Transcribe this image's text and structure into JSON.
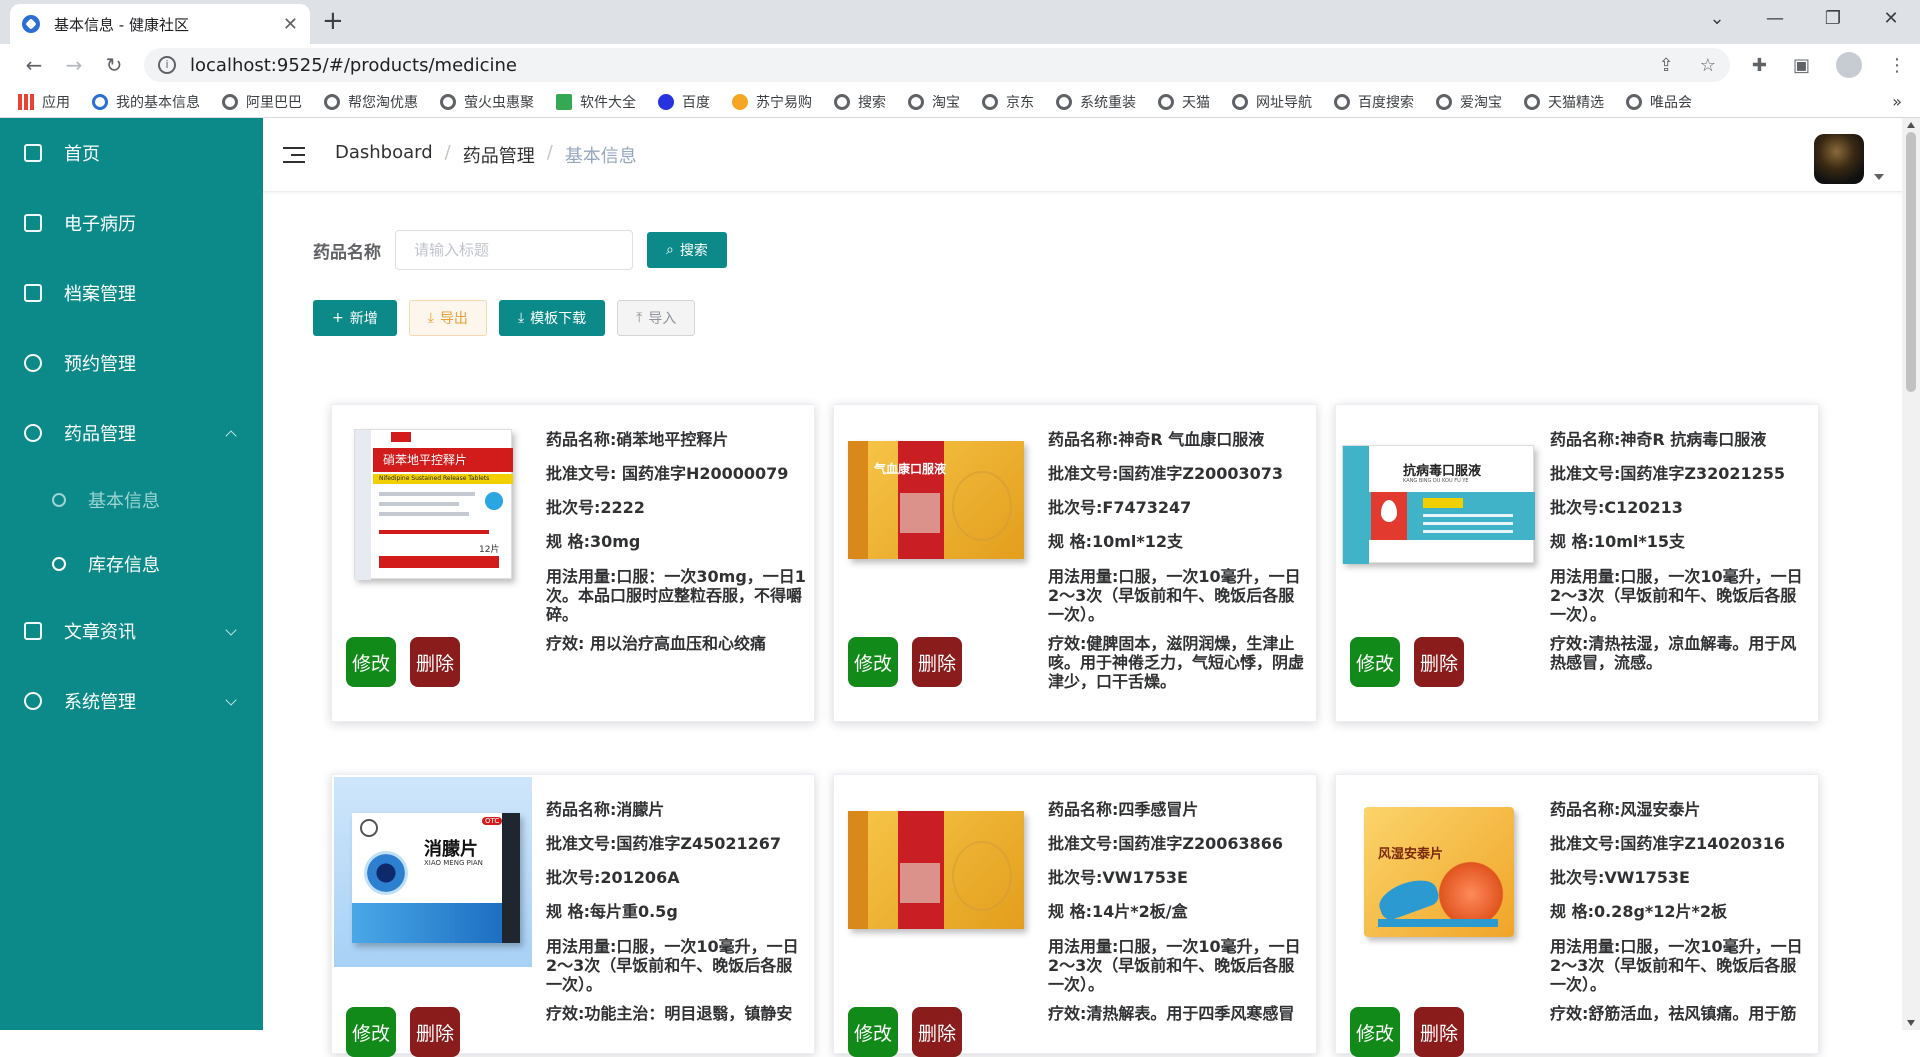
{
  "browser": {
    "tab_title": "基本信息 - 健康社区",
    "url": "localhost:9525/#/products/medicine",
    "bookmarks": [
      "应用",
      "我的基本信息",
      "阿里巴巴",
      "帮您淘优惠",
      "萤火虫惠聚",
      "软件大全",
      "百度",
      "苏宁易购",
      "搜索",
      "淘宝",
      "京东",
      "系统重装",
      "天猫",
      "网址导航",
      "百度搜索",
      "爱淘宝",
      "天猫精选",
      "唯品会"
    ],
    "bookmark_more": "»"
  },
  "sidebar": {
    "items": [
      {
        "label": "首页",
        "icon": "home-icon"
      },
      {
        "label": "电子病历",
        "icon": "document-icon"
      },
      {
        "label": "档案管理",
        "icon": "folder-icon"
      },
      {
        "label": "预约管理",
        "icon": "clock-icon"
      },
      {
        "label": "药品管理",
        "icon": "link-icon"
      },
      {
        "label": "基本信息",
        "icon": "link-icon"
      },
      {
        "label": "库存信息",
        "icon": "database-icon"
      },
      {
        "label": "文章资讯",
        "icon": "article-icon"
      },
      {
        "label": "系统管理",
        "icon": "user-icon"
      }
    ]
  },
  "header": {
    "breadcrumb": [
      "Dashboard",
      "药品管理",
      "基本信息"
    ],
    "separator": "/"
  },
  "search": {
    "label": "药品名称",
    "placeholder": "请输入标题",
    "button": "搜索"
  },
  "toolbar": {
    "add": "新增",
    "export": "导出",
    "template": "模板下载",
    "import": "导入"
  },
  "actions": {
    "edit": "修改",
    "delete": "删除"
  },
  "cards": [
    {
      "name": "药品名称:硝苯地平控释片",
      "approval": "批准文号: 国药准字H20000079",
      "batch": "批次号:2222",
      "spec": "规 格:30mg",
      "usage": "用法用量:口服：一次30mg，一日1次。本品口服时应整粒吞服，不得嚼碎。",
      "effect": "疗效: 用以治疗高血压和心绞痛"
    },
    {
      "name": "药品名称:神奇R 气血康口服液",
      "approval": "批准文号:国药准字Z20003073",
      "batch": "批次号:F7473247",
      "spec": "规 格:10ml*12支",
      "usage": "用法用量:口服，一次10毫升，一日2～3次（早饭前和午、晚饭后各服一次）。",
      "effect": "疗效:健脾固本，滋阴润燥，生津止咳。用于神倦乏力，气短心悸，阴虚津少，口干舌燥。"
    },
    {
      "name": "药品名称:神奇R 抗病毒口服液",
      "approval": "批准文号:国药准字Z32021255",
      "batch": "批次号:C120213",
      "spec": "规 格:10ml*15支",
      "usage": "用法用量:口服，一次10毫升，一日2～3次（早饭前和午、晚饭后各服一次）。",
      "effect": "疗效:清热祛湿，凉血解毒。用于风热感冒，流感。"
    },
    {
      "name": "药品名称:消朦片",
      "approval": "批准文号:国药准字Z45021267",
      "batch": "批次号:201206A",
      "spec": "规 格:每片重0.5g",
      "usage": "用法用量:口服，一次10毫升，一日2～3次（早饭前和午、晚饭后各服一次）。",
      "effect": "疗效:功能主治：明目退翳，镇静安"
    },
    {
      "name": "药品名称:四季感冒片",
      "approval": "批准文号:国药准字Z20063866",
      "batch": "批次号:VW1753E",
      "spec": "规 格:14片*2板/盒",
      "usage": "用法用量:口服，一次10毫升，一日2～3次（早饭前和午、晚饭后各服一次）。",
      "effect": "疗效:清热解表。用于四季风寒感冒"
    },
    {
      "name": "药品名称:风湿安泰片",
      "approval": "批准文号:国药准字Z14020316",
      "batch": "批次号:VW1753E",
      "spec": "规 格:0.28g*12片*2板",
      "usage": "用法用量:口服，一次10毫升，一日2～3次（早饭前和午、晚饭后各服一次）。",
      "effect": "疗效:舒筋活血，祛风镇痛。用于筋"
    }
  ],
  "product_art": {
    "nifedipine": {
      "title": "硝苯地平控释片",
      "sub": "Nifedipine Sustained Release Tablets",
      "count": "12片"
    },
    "qixuekang": {
      "title": "气血康口服液"
    },
    "kangbingdu": {
      "title": "抗病毒口服液",
      "sub": "KANG BING DU KOU FU YE"
    },
    "xiaomeng": {
      "title": "消朦片",
      "sub": "XIAO MENG PIAN",
      "badge": "OTC"
    },
    "fengshi": {
      "title": "风湿安泰片"
    }
  },
  "colors": {
    "sidebar": "#0b8a89",
    "accent": "#0b8a89",
    "edit": "#128a1a",
    "delete": "#8a1c1c"
  }
}
